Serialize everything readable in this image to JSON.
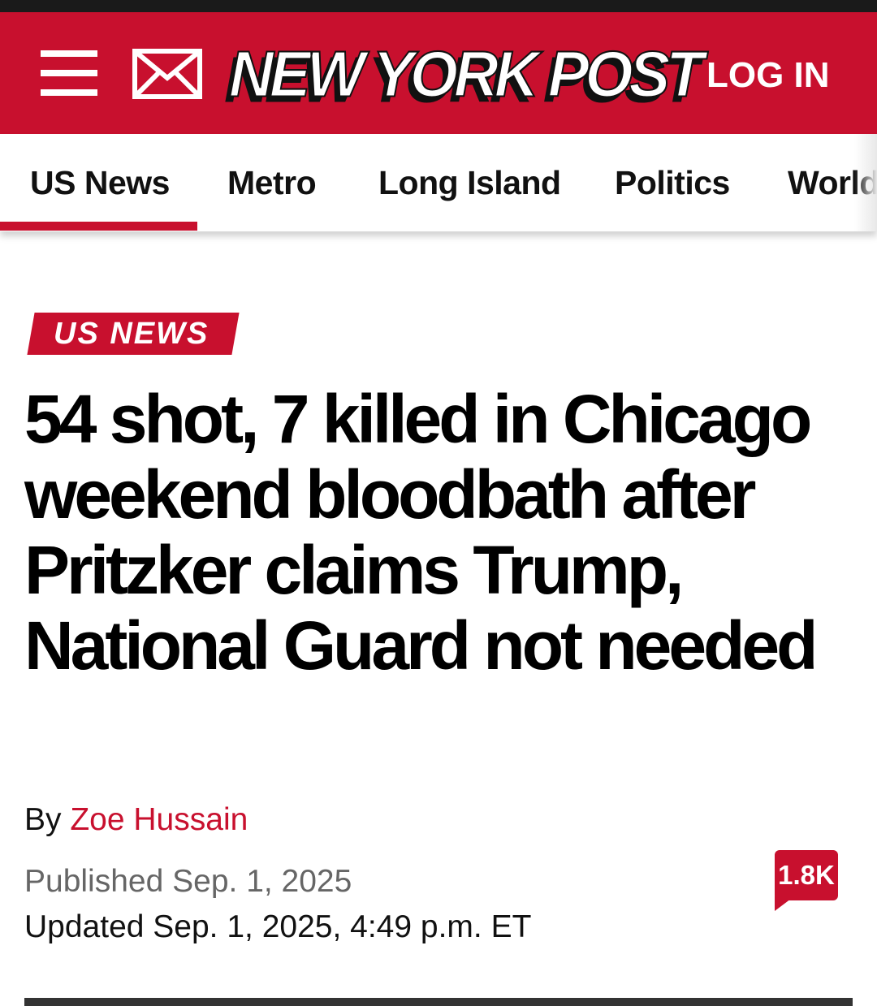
{
  "header": {
    "logo_text": "NEW YORK POST",
    "login_label": "LOG IN",
    "menu_icon": "hamburger-menu-icon",
    "newsletter_icon": "envelope-icon"
  },
  "nav": {
    "items": [
      {
        "label": "US News",
        "active": true
      },
      {
        "label": "Metro",
        "active": false
      },
      {
        "label": "Long Island",
        "active": false
      },
      {
        "label": "Politics",
        "active": false
      },
      {
        "label": "World",
        "active": false
      }
    ]
  },
  "article": {
    "section": "US NEWS",
    "headline": "54 shot, 7 killed in Chicago weekend bloodbath after Pritzker claims Trump, National Guard not needed",
    "byline_prefix": "By",
    "author": "Zoe Hussain",
    "published": "Published Sep. 1, 2025",
    "updated": "Updated Sep. 1, 2025, 4:49 p.m. ET",
    "comment_count": "1.8K"
  },
  "colors": {
    "brand_red": "#c8102e",
    "text": "#111111",
    "muted": "#666666"
  }
}
